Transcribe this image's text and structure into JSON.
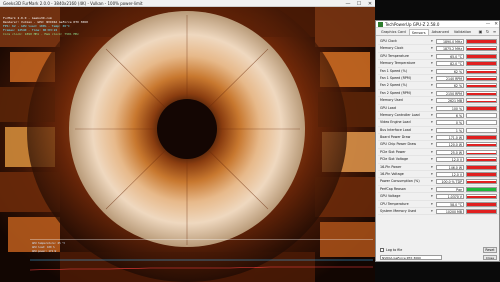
{
  "furmark": {
    "title": "Geeks3D FurMark 2.0.0 - 3840x2160 (4K) - Vulkan - 100% power-limit",
    "controls": {
      "minimize": "—",
      "maximize": "☐",
      "close": "✕"
    },
    "hud": [
      {
        "text": "FurMark 2.0.0 - Geeks3D.com",
        "style": "main"
      },
      {
        "text": "Renderer: Vulkan - GPU: NVIDIA GeForce RTX 3060",
        "style": "main"
      },
      {
        "text": "FPS: 62 - GPU load: 100% - Temp: 65°C",
        "style": "cyan"
      },
      {
        "text": "Frames: 12540 - Time: 00:03:22",
        "style": "cyan"
      },
      {
        "text": "Core clock: 1890 MHz - Mem clock: 7501 MHz",
        "style": "green"
      }
    ],
    "graph": {
      "labels": [
        "GPU temperature: 65 °C",
        "GPU load: 100 %",
        "GPU power: 171 W"
      ]
    }
  },
  "gpuz": {
    "title": "TechPowerUp GPU-Z 2.58.0",
    "controls": {
      "minimize": "—",
      "close": "✕"
    },
    "tabs": [
      "Graphics Card",
      "Sensors",
      "Advanced",
      "Validation"
    ],
    "active_tab": "Sensors",
    "tab_icons": {
      "camera": "▣",
      "refresh": "↻",
      "menu": "≡"
    },
    "sensors": [
      {
        "name": "GPU Clock",
        "value": "1890.0 MHz",
        "level": 0.9,
        "color": "#e02020"
      },
      {
        "name": "Memory Clock",
        "value": "1875.2 MHz",
        "level": 0.95,
        "color": "#e02020"
      },
      {
        "name": "GPU Temperature",
        "value": "65.0 °C",
        "level": 0.85,
        "color": "#e02020"
      },
      {
        "name": "Memory Temperature",
        "value": "82.0 °C",
        "level": 0.9,
        "color": "#e02020"
      },
      {
        "name": "Fan 1 Speed (%)",
        "value": "62 %",
        "level": 0.62,
        "color": "#e02020"
      },
      {
        "name": "Fan 1 Speed (RPM)",
        "value": "2140 RPM",
        "level": 0.62,
        "color": "#e02020"
      },
      {
        "name": "Fan 2 Speed (%)",
        "value": "62 %",
        "level": 0.62,
        "color": "#e02020"
      },
      {
        "name": "Fan 2 Speed (RPM)",
        "value": "2150 RPM",
        "level": 0.62,
        "color": "#e02020"
      },
      {
        "name": "Memory Used",
        "value": "2621 MB",
        "level": 0.3,
        "color": "#e02020"
      },
      {
        "name": "GPU Load",
        "value": "100 %",
        "level": 1.0,
        "color": "#e02020"
      },
      {
        "name": "Memory Controller Load",
        "value": "6 %",
        "level": 0.06,
        "color": "#e02020"
      },
      {
        "name": "Video Engine Load",
        "value": "0 %",
        "level": 0.0,
        "color": "#e02020"
      },
      {
        "name": "Bus Interface Load",
        "value": "1 %",
        "level": 0.02,
        "color": "#e02020"
      },
      {
        "name": "Board Power Draw",
        "value": "171.0 W",
        "level": 0.95,
        "color": "#e02020"
      },
      {
        "name": "GPU Chip Power Draw",
        "value": "120.0 W",
        "level": 0.9,
        "color": "#e02020"
      },
      {
        "name": "PCIe Slot Power",
        "value": "25.0 W",
        "level": 0.35,
        "color": "#e02020"
      },
      {
        "name": "PCIe Slot Voltage",
        "value": "12.0 V",
        "level": 0.9,
        "color": "#e02020"
      },
      {
        "name": "16-Pin Power",
        "value": "146.0 W",
        "level": 0.9,
        "color": "#e02020"
      },
      {
        "name": "16-Pin Voltage",
        "value": "12.0 V",
        "level": 0.9,
        "color": "#e02020"
      },
      {
        "name": "Power Consumption (%)",
        "value": "100.0 % TDP",
        "level": 0.95,
        "color": "#e02020"
      },
      {
        "name": "PerfCap Reason",
        "value": "Pwr",
        "level": 1.0,
        "color": "#1eb83a"
      },
      {
        "name": "GPU Voltage",
        "value": "1.0370 V",
        "level": 0.9,
        "color": "#e02020"
      },
      {
        "name": "CPU Temperature",
        "value": "58.0 °C",
        "level": 0.8,
        "color": "#e02020"
      },
      {
        "name": "System Memory Used",
        "value": "10200 MB",
        "level": 0.9,
        "color": "#e02020"
      }
    ],
    "log_label": "Log to file",
    "reset_label": "Reset",
    "gpu_select": "NVIDIA GeForce RTX 3060",
    "close_label": "Close"
  }
}
